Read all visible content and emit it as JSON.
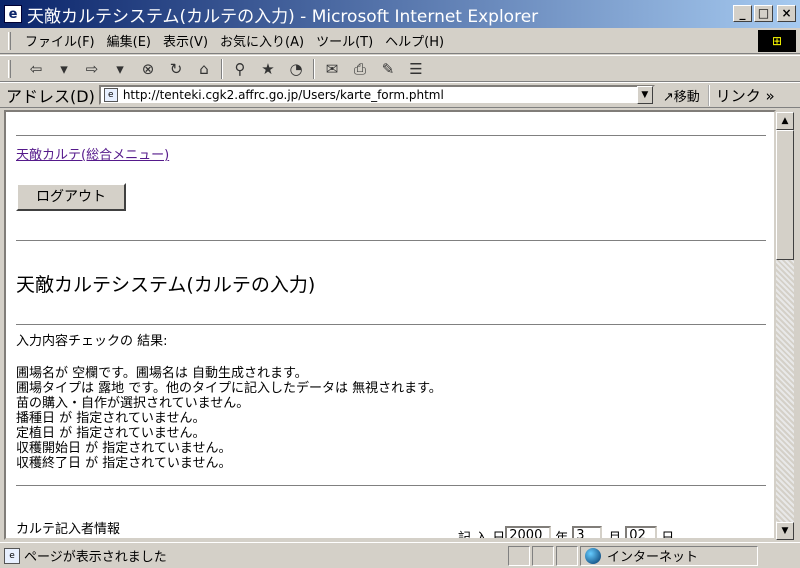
{
  "window": {
    "title": "天敵カルテシステム(カルテの入力) - Microsoft Internet Explorer",
    "buttons": {
      "minimize": "_",
      "maximize": "□",
      "close": "×"
    }
  },
  "menu": {
    "items": [
      "ファイル(F)",
      "編集(E)",
      "表示(V)",
      "お気に入り(A)",
      "ツール(T)",
      "ヘルプ(H)"
    ]
  },
  "toolbar": {
    "icons": [
      "back-icon",
      "forward-icon",
      "stop-icon",
      "refresh-icon",
      "home-icon",
      "search-icon",
      "favorites-icon",
      "history-icon",
      "mail-icon",
      "print-icon",
      "edit-icon",
      "discuss-icon"
    ]
  },
  "address": {
    "label": "アドレス(D)",
    "url": "http://tenteki.cgk2.affrc.go.jp/Users/karte_form.phtml",
    "go_label": "移動",
    "links_label": "リンク"
  },
  "page": {
    "menu_link": "天敵カルテ(総合メニュー)",
    "logout_label": "ログアウト",
    "heading": "天敵カルテシステム(カルテの入力)",
    "check_result_label": "入力内容チェックの 結果:",
    "messages": [
      "圃場名が 空欄です。圃場名は 自動生成されます。",
      "圃場タイプは 露地 です。他のタイプに記入したデータは 無視されます。",
      "苗の購入・自作が選択されていません。",
      "播種日 が 指定されていません。",
      "定植日 が 指定されていません。",
      "収穫開始日 が 指定されていません。",
      "収穫終了日 が 指定されていません。"
    ],
    "section_label": "カルテ記入者情報",
    "date": {
      "label": "記 入 日",
      "year": "2000",
      "year_unit": "年",
      "month": "3",
      "month_unit": "月",
      "day": "02",
      "day_unit": "日"
    }
  },
  "status": {
    "text": "ページが表示されました",
    "zone": "インターネット"
  }
}
